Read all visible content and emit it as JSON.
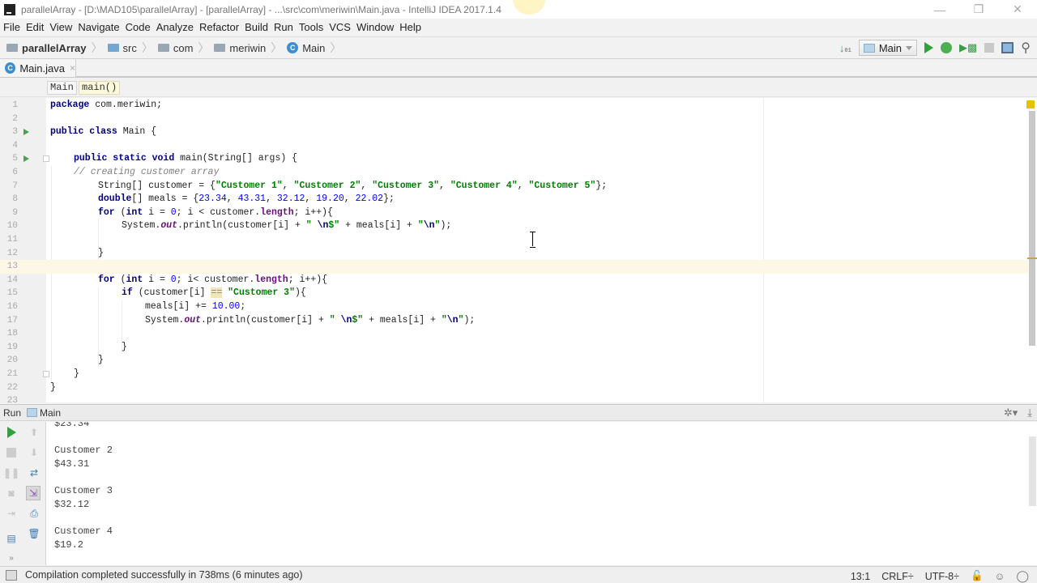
{
  "window": {
    "title": "parallelArray - [D:\\MAD105\\parallelArray] - [parallelArray] - ...\\src\\com\\meriwin\\Main.java - IntelliJ IDEA 2017.1.4",
    "controls": {
      "minimize": "—",
      "restore": "❐",
      "close": "✕"
    }
  },
  "menu": [
    "File",
    "Edit",
    "View",
    "Navigate",
    "Code",
    "Analyze",
    "Refactor",
    "Build",
    "Run",
    "Tools",
    "VCS",
    "Window",
    "Help"
  ],
  "navbar": {
    "crumbs": [
      "parallelArray",
      "src",
      "com",
      "meriwin",
      "Main"
    ],
    "run_config": "Main",
    "icons": [
      "sort-numbers-icon",
      "run-icon",
      "debug-icon",
      "coverage-icon",
      "stop-icon",
      "project-structure-icon",
      "search-icon"
    ]
  },
  "tabs": [
    {
      "label": "Main.java",
      "close": "×"
    }
  ],
  "editor_breadcrumb": [
    "Main",
    "main()"
  ],
  "editor": {
    "current_line": 13,
    "line_numbers": [
      "1",
      "2",
      "3",
      "4",
      "5",
      "6",
      "7",
      "8",
      "9",
      "10",
      "11",
      "12",
      "13",
      "14",
      "15",
      "16",
      "17",
      "18",
      "19",
      "20",
      "21",
      "22",
      "23"
    ],
    "lines": {
      "l1": [
        "package",
        " com.meriwin;"
      ],
      "l3": [
        "public class",
        " Main {"
      ],
      "l5": [
        "public static void",
        " main(String[] args) {"
      ],
      "l6": "// creating customer array",
      "l7": [
        "String[] customer = {",
        "\"Customer 1\"",
        ", ",
        "\"Customer 2\"",
        ", ",
        "\"Customer 3\"",
        ", ",
        "\"Customer 4\"",
        ", ",
        "\"Customer 5\"",
        "};"
      ],
      "l8": [
        "double",
        "[] meals = {",
        "23.34",
        ", ",
        "43.31",
        ", ",
        "32.12",
        ", ",
        "19.20",
        ", ",
        "22.02",
        "};"
      ],
      "l9": [
        "for",
        " (",
        "int",
        " i = ",
        "0",
        "; i < customer.",
        "length",
        "; i++){"
      ],
      "l10": [
        "System.",
        "out",
        ".println(customer[i] + ",
        "\" ",
        "\\n",
        "$\"",
        " + meals[i] + ",
        "\"",
        "\\n",
        "\"",
        ");"
      ],
      "l12": "}",
      "l14": [
        "for",
        " (",
        "int",
        " i = ",
        "0",
        "; i< customer.",
        "length",
        "; i++){"
      ],
      "l15": [
        "if",
        " (customer[i] ",
        "==",
        " ",
        "\"Customer 3\"",
        "){"
      ],
      "l16": [
        "meals[i] += ",
        "10.00",
        ";"
      ],
      "l17": [
        "System.",
        "out",
        ".println(customer[i] + ",
        "\" ",
        "\\n",
        "$\"",
        " + meals[i] + ",
        "\"",
        "\\n",
        "\"",
        ");"
      ],
      "l19": "}",
      "l20": "}",
      "l21": "}",
      "l22": "}"
    }
  },
  "run_panel": {
    "label": "Run",
    "config": "Main",
    "output": [
      "$23.34",
      "",
      "Customer 2",
      "$43.31",
      "",
      "Customer 3",
      "$32.12",
      "",
      "Customer 4",
      "$19.2"
    ]
  },
  "status": {
    "message": "Compilation completed successfully in 738ms (6 minutes ago)",
    "position": "13:1",
    "line_sep": "CRLF÷",
    "encoding": "UTF-8÷"
  }
}
